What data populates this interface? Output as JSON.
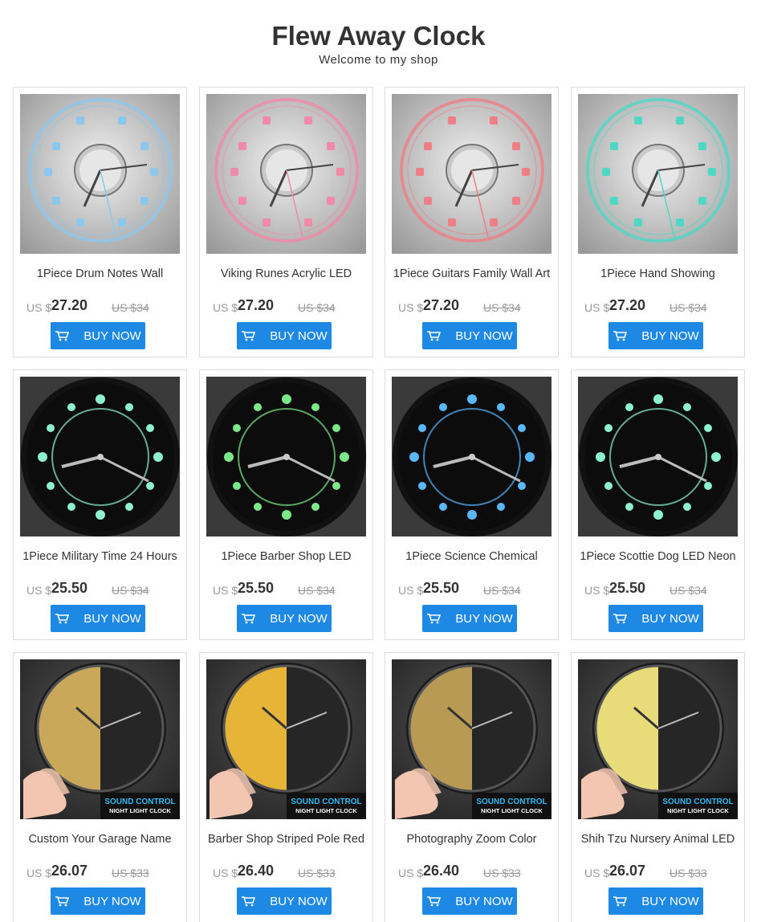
{
  "shop": {
    "title": "Flew Away Clock",
    "subtitle": "Welcome to my shop"
  },
  "buy_label": "BUY NOW",
  "currency": "US $",
  "products": [
    {
      "name": "1Piece Drum Notes Wall",
      "price": "27.20",
      "old_price": "US $34",
      "theme": "light",
      "glow": "#8cc8ee"
    },
    {
      "name": "Viking Runes Acrylic LED",
      "price": "27.20",
      "old_price": "US $34",
      "theme": "light",
      "glow": "#f08aa8"
    },
    {
      "name": "1Piece Guitars Family Wall Art",
      "price": "27.20",
      "old_price": "US $34",
      "theme": "light",
      "glow": "#ee7f86"
    },
    {
      "name": "1Piece Hand Showing",
      "price": "27.20",
      "old_price": "US $34",
      "theme": "light",
      "glow": "#4fd8c4"
    },
    {
      "name": "1Piece Military Time 24 Hours",
      "price": "25.50",
      "old_price": "US $34",
      "theme": "dark",
      "glow": "#8ef0cc"
    },
    {
      "name": "1Piece Barber Shop LED",
      "price": "25.50",
      "old_price": "US $34",
      "theme": "dark",
      "glow": "#7be88a"
    },
    {
      "name": "1Piece Science Chemical",
      "price": "25.50",
      "old_price": "US $34",
      "theme": "dark",
      "glow": "#5ab8ff"
    },
    {
      "name": "1Piece Scottie Dog LED Neon",
      "price": "25.50",
      "old_price": "US $34",
      "theme": "dark",
      "glow": "#8cf2d2"
    },
    {
      "name": "Custom Your Garage Name",
      "price": "26.07",
      "old_price": "US $33",
      "theme": "sound",
      "glow": "#c9a85a",
      "badge1": "SOUND CONTROL",
      "badge2": "NIGHT LIGHT CLOCK"
    },
    {
      "name": "Barber Shop Striped Pole Red",
      "price": "26.40",
      "old_price": "US $33",
      "theme": "sound",
      "glow": "#e6b437",
      "badge1": "SOUND CONTROL",
      "badge2": "NIGHT LIGHT CLOCK"
    },
    {
      "name": "Photography Zoom Color",
      "price": "26.40",
      "old_price": "US $33",
      "theme": "sound",
      "glow": "#b89a54",
      "badge1": "SOUND CONTROL",
      "badge2": "NIGHT LIGHT CLOCK"
    },
    {
      "name": "Shih Tzu Nursery Animal LED",
      "price": "26.07",
      "old_price": "US $33",
      "theme": "sound",
      "glow": "#e8dc7a",
      "badge1": "SOUND CONTROL",
      "badge2": "NIGHT LIGHT CLOCK"
    }
  ]
}
